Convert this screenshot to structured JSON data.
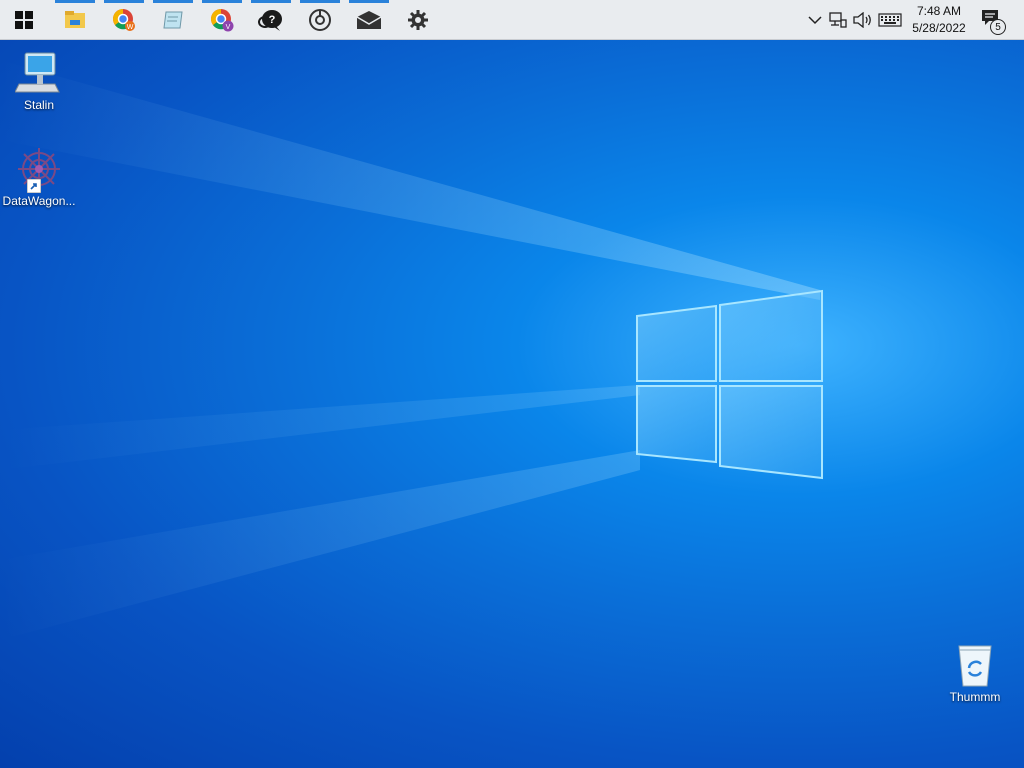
{
  "desktop": {
    "icons": [
      {
        "label": "Stalin",
        "icon": "computer-icon"
      },
      {
        "label": "DataWagon...",
        "icon": "datawagon-app-icon"
      },
      {
        "label": "Thummm",
        "icon": "recycle-bin-icon"
      }
    ]
  },
  "taskbar": {
    "start_icon": "windows-logo-icon",
    "apps": [
      {
        "icon": "file-explorer-icon",
        "running": true
      },
      {
        "icon": "chrome-profile-w-icon",
        "running": true
      },
      {
        "icon": "notepad-icon",
        "running": true
      },
      {
        "icon": "chrome-profile-v-icon",
        "running": true
      },
      {
        "icon": "help-chat-icon",
        "running": true
      },
      {
        "icon": "media-disc-icon",
        "running": true
      },
      {
        "icon": "mail-icon",
        "running": true
      },
      {
        "icon": "settings-gear-icon",
        "running": false
      }
    ],
    "tray": {
      "icons": [
        "chevron-up-icon",
        "network-icon",
        "volume-icon",
        "keyboard-icon"
      ],
      "time": "7:48 AM",
      "date": "5/28/2022",
      "notification_count": "5"
    }
  },
  "colors": {
    "taskbar_bg": "#e9ecef",
    "running_indicator": "#2a82da",
    "desktop_blue": "#0a6fd8"
  }
}
